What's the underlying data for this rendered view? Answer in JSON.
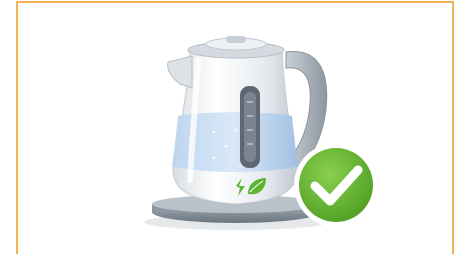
{
  "image": {
    "frame_color": "#f0b357",
    "colors": {
      "kettle_body": "#e9ecef",
      "kettle_highlight": "#ffffff",
      "kettle_shadow": "#a9b3bd",
      "handle": "#9aa4ad",
      "water": "#a9c8ea",
      "water_dark": "#7fa9d8",
      "gauge": "#5d6873",
      "base": "#6e7882",
      "leaf": "#5cb531",
      "check_badge": "#5aad2c",
      "check_mark": "#ffffff"
    },
    "icons": [
      "kettle-icon",
      "water-level-gauge-icon",
      "eco-energy-leaf-icon",
      "check-badge-icon"
    ]
  }
}
